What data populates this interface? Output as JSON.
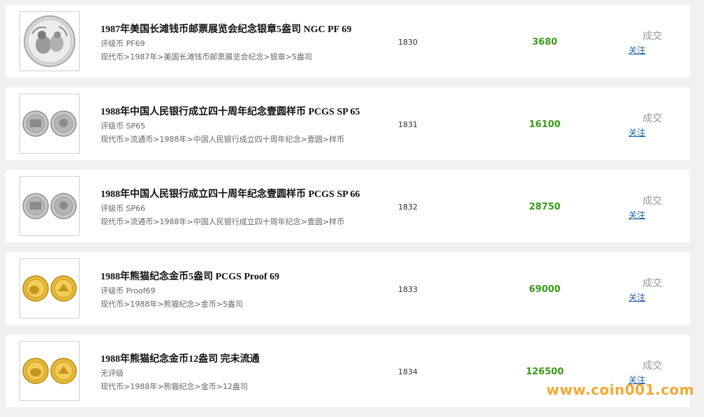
{
  "items": [
    {
      "title": "1987年美国长滩钱币邮票展览会纪念银章5盎司 NGC PF 69",
      "grade": "评级币 PF69",
      "category": "现代币>1987年>美国长滩钱币邮票展览会纪念>银章>5盎司",
      "lot": "1830",
      "price": "3680",
      "status": "成交",
      "follow": "关注",
      "image": "silver-panda-medal"
    },
    {
      "title": "1988年中国人民银行成立四十周年纪念壹圆样币 PCGS SP 65",
      "grade": "评级币 SP65",
      "category": "现代币>流通币>1988年>中国人民银行成立四十周年纪念>壹圆>样币",
      "lot": "1831",
      "price": "16100",
      "status": "成交",
      "follow": "关注",
      "image": "nickel-coin-pair"
    },
    {
      "title": "1988年中国人民银行成立四十周年纪念壹圆样币 PCGS SP 66",
      "grade": "评级币 SP66",
      "category": "现代币>流通币>1988年>中国人民银行成立四十周年纪念>壹圆>样币",
      "lot": "1832",
      "price": "28750",
      "status": "成交",
      "follow": "关注",
      "image": "nickel-coin-pair"
    },
    {
      "title": "1988年熊猫纪念金币5盎司 PCGS Proof 69",
      "grade": "评级币 Proof69",
      "category": "现代币>1988年>熊猫纪念>金币>5盎司",
      "lot": "1833",
      "price": "69000",
      "status": "成交",
      "follow": "关注",
      "image": "gold-coin-pair"
    },
    {
      "title": "1988年熊猫纪念金币12盎司 完未流通",
      "grade": "无评级",
      "category": "现代币>1988年>熊猫纪念>金币>12盎司",
      "lot": "1834",
      "price": "126500",
      "status": "成交",
      "follow": "关注",
      "image": "gold-coin-pair"
    }
  ],
  "watermark": "www.coin001.com",
  "colors": {
    "price": "#3a9a1a",
    "link": "#1a5fa8",
    "status": "#999999",
    "watermark": "#f0a020"
  }
}
